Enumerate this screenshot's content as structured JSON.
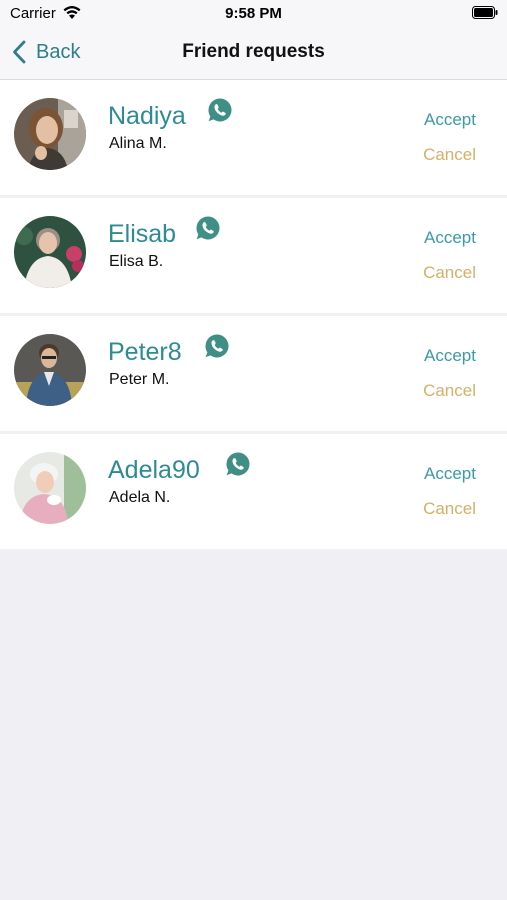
{
  "status_bar": {
    "carrier": "Carrier",
    "time": "9:58 PM"
  },
  "nav": {
    "back_label": "Back",
    "title": "Friend requests"
  },
  "requests": [
    {
      "username": "Nadiya",
      "full_name": "Alina M.",
      "accept_label": "Accept",
      "cancel_label": "Cancel"
    },
    {
      "username": "Elisab",
      "full_name": "Elisa B.",
      "accept_label": "Accept",
      "cancel_label": "Cancel"
    },
    {
      "username": "Peter8",
      "full_name": "Peter M.",
      "accept_label": "Accept",
      "cancel_label": "Cancel"
    },
    {
      "username": "Adela90",
      "full_name": "Adela N.",
      "accept_label": "Accept",
      "cancel_label": "Cancel"
    }
  ],
  "colors": {
    "accent": "#2e8b94",
    "accept": "#3a9aa6",
    "cancel": "#d4b06a",
    "chat_icon": "#3f8f86"
  }
}
